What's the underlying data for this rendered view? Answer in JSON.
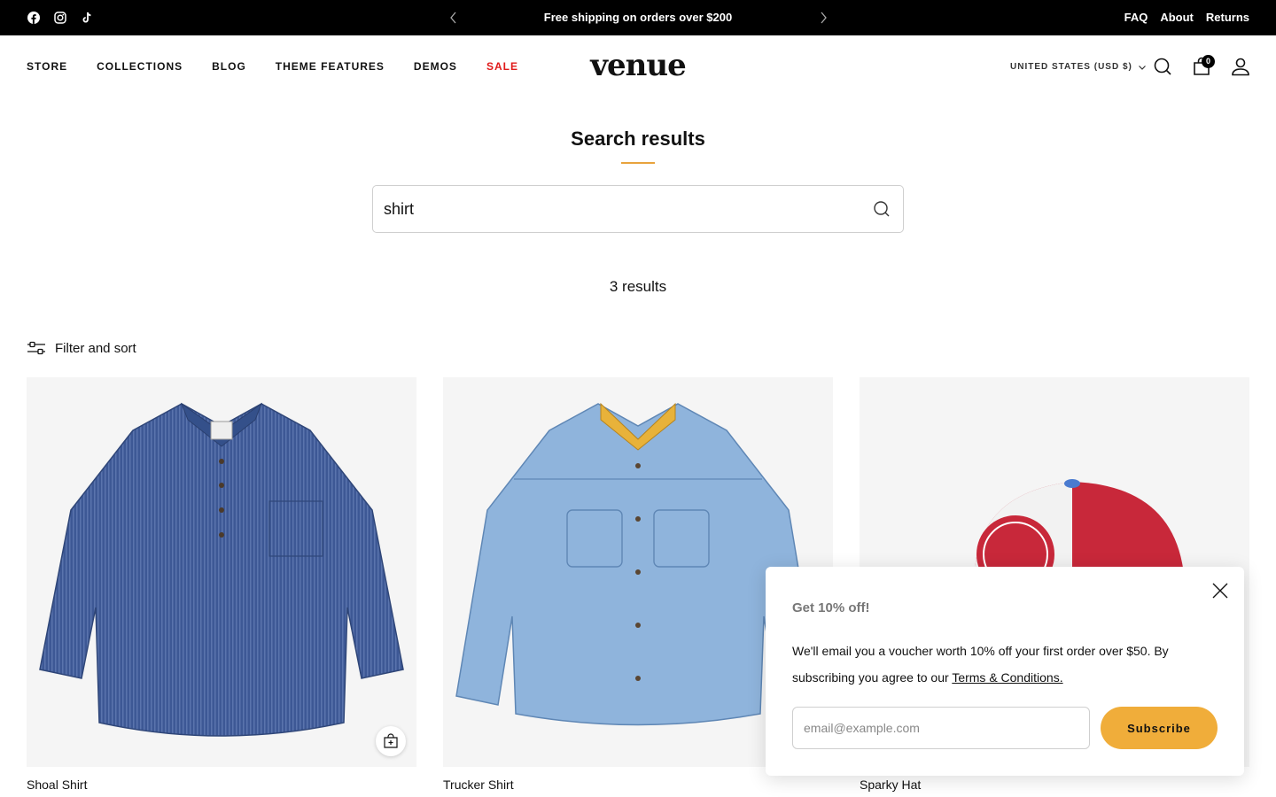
{
  "announcement": {
    "social": [
      {
        "name": "facebook-icon"
      },
      {
        "name": "instagram-icon"
      },
      {
        "name": "tiktok-icon"
      }
    ],
    "message": "Free shipping on orders over $200",
    "utility_links": [
      "FAQ",
      "About",
      "Returns"
    ]
  },
  "header": {
    "nav": [
      "STORE",
      "COLLECTIONS",
      "BLOG",
      "THEME FEATURES",
      "DEMOS",
      "SALE"
    ],
    "logo": "venue",
    "country": "UNITED STATES (USD $)",
    "cart_count": "0",
    "sale_color": "#e01a1a"
  },
  "search": {
    "title": "Search results",
    "query": "shirt",
    "results_count": "3 results",
    "accent_color": "#e8a33d"
  },
  "filter": {
    "label": "Filter and sort"
  },
  "products": [
    {
      "name": "Shoal Shirt"
    },
    {
      "name": "Trucker Shirt"
    },
    {
      "name": "Sparky Hat"
    }
  ],
  "popup": {
    "title": "Get 10% off!",
    "body": "We'll email you a voucher worth 10% off your first order over $50. By subscribing you agree to our ",
    "terms_link": "Terms & Conditions.",
    "email_placeholder": "email@example.com",
    "button_label": "Subscribe",
    "button_color": "#f0ad3a"
  }
}
